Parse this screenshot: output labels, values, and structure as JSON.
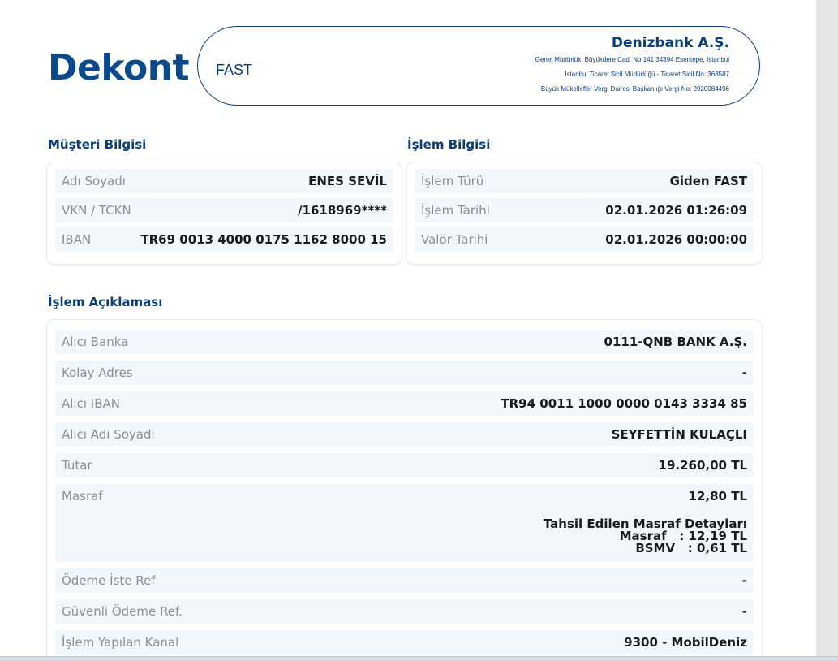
{
  "header": {
    "title": "Dekont",
    "type": "FAST",
    "bank_name": "Denizbank A.Ş.",
    "bank_line1": "Genel Müdürlük: Büyükdere Cad. No:141 34394 Esentepe, İstanbul",
    "bank_line2": "İstanbul Ticaret Sicil Müdürlüğü - Ticaret Sicil No: 368587",
    "bank_line3": "Büyük Mükellefler Vergi Dairesi Başkanlığı Vergi No: 2920084496"
  },
  "customer": {
    "title": "Müşteri Bilgisi",
    "rows": [
      {
        "label": "Adı Soyadı",
        "value": "ENES SEVİL"
      },
      {
        "label": "VKN / TCKN",
        "value": "/1618969****"
      },
      {
        "label": "IBAN",
        "value": "TR69 0013 4000 0175 1162 8000 15"
      }
    ]
  },
  "transaction": {
    "title": "İşlem Bilgisi",
    "rows": [
      {
        "label": "İşlem Türü",
        "value": "Giden FAST"
      },
      {
        "label": "İşlem Tarihi",
        "value": "02.01.2026 01:26:09"
      },
      {
        "label": "Valör Tarihi",
        "value": "02.01.2026 00:00:00"
      }
    ]
  },
  "description": {
    "title": "İşlem Açıklaması",
    "rows": [
      {
        "label": "Alıcı Banka",
        "value": "0111-QNB BANK A.Ş."
      },
      {
        "label": "Kolay Adres",
        "value": "-"
      },
      {
        "label": "Alıcı IBAN",
        "value": "TR94 0011 1000 0000 0143 3334 85"
      },
      {
        "label": "Alıcı Adı Soyadı",
        "value": "SEYFETTİN KULAÇLI"
      },
      {
        "label": "Tutar",
        "value": "19.260,00 TL"
      },
      {
        "label": "Masraf",
        "value": "12,80 TL"
      },
      {
        "label": "Ödeme İste Ref",
        "value": "-"
      },
      {
        "label": "Güvenli Ödeme Ref.",
        "value": "-"
      },
      {
        "label": "İşlem Yapılan Kanal",
        "value": "9300 - MobilDeniz"
      }
    ],
    "fee_details": {
      "heading": "Tahsil Edilen Masraf Detayları",
      "line1": "Masraf   : 12,19 TL",
      "line2": "BSMV   : 0,61 TL"
    }
  }
}
